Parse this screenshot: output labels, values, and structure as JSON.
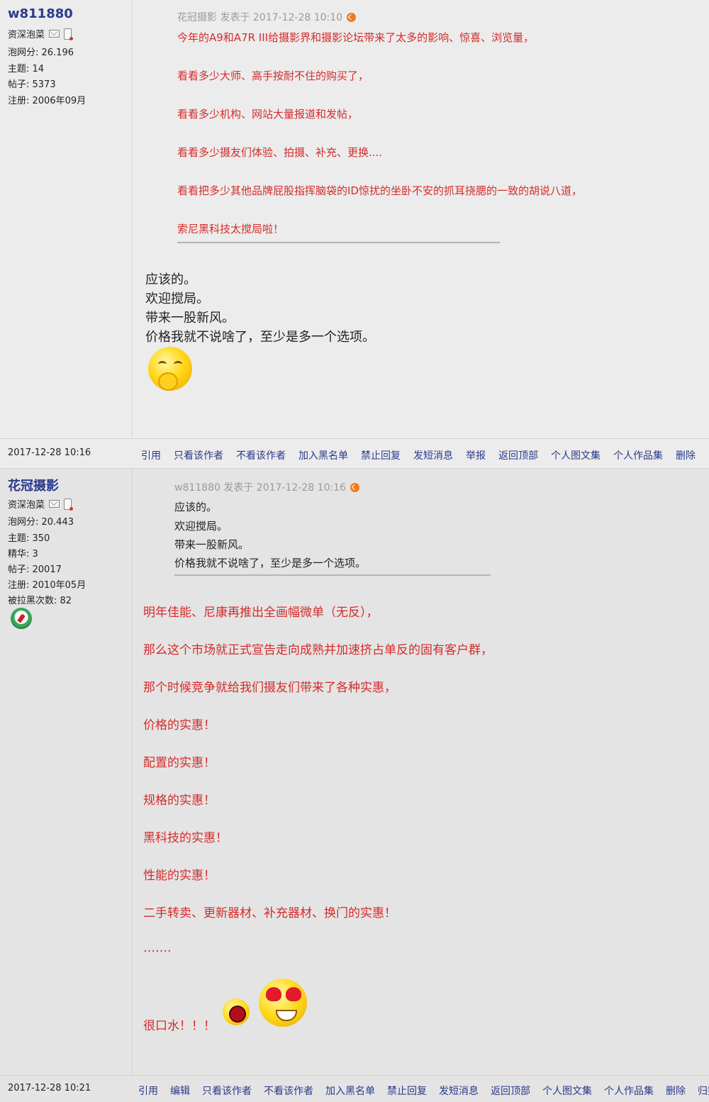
{
  "post1": {
    "author": {
      "name": "w811880",
      "rank": "资深泡菜",
      "stats": [
        "泡网分: 26.196",
        "主题: 14",
        "帖子: 5373",
        "注册: 2006年09月"
      ]
    },
    "quote": {
      "header": "花冠摄影 发表于 2017-12-28 10:10",
      "lines": [
        "今年的A9和A7R III给摄影界和摄影论坛带来了太多的影响、惊喜、浏览量，",
        "看看多少大师、高手按耐不住的购买了，",
        "看看多少机构、网站大量报道和发帖，",
        "看看多少摄友们体验、拍摄、补充、更换....",
        "看看把多少其他品牌屁股指挥脑袋的ID惊扰的坐卧不安的抓耳挠腮的一致的胡说八道，",
        "索尼黑科技太搅局啦！"
      ]
    },
    "reply": [
      "应该的。",
      "欢迎搅局。",
      "带来一股新风。",
      "价格我就不说啥了，至少是多一个选项。"
    ],
    "footer": {
      "time": "2017-12-28 10:16",
      "actions": [
        "引用",
        "只看该作者",
        "不看该作者",
        "加入黑名单",
        "禁止回复",
        "发短消息",
        "举报",
        "返回顶部",
        "个人图文集",
        "个人作品集",
        "删除"
      ]
    }
  },
  "post2": {
    "author": {
      "name": "花冠摄影",
      "rank": "资深泡菜",
      "stats": [
        "泡网分: 20.443",
        "主题: 350",
        "精华: 3",
        "帖子: 20017",
        "注册: 2010年05月",
        "被拉黑次数: 82"
      ]
    },
    "quote": {
      "header": "w811880 发表于 2017-12-28 10:16",
      "lines": [
        "应该的。",
        "欢迎搅局。",
        "带来一股新风。",
        "价格我就不说啥了，至少是多一个选项。"
      ]
    },
    "reply": [
      "明年佳能、尼康再推出全画幅微单（无反），",
      "那么这个市场就正式宣告走向成熟并加速挤占单反的固有客户群，",
      "那个时候竞争就给我们摄友们带来了各种实惠，",
      "价格的实惠！",
      "配置的实惠！",
      "规格的实惠！",
      "黑科技的实惠！",
      "性能的实惠！",
      "二手转卖、更新器材、补充器材、换门的实惠！",
      "……."
    ],
    "closing": "很口水！！！",
    "footer": {
      "time": "2017-12-28 10:21",
      "actions": [
        "引用",
        "编辑",
        "只看该作者",
        "不看该作者",
        "加入黑名单",
        "禁止回复",
        "发短消息",
        "返回顶部",
        "个人图文集",
        "个人作品集",
        "删除",
        "归鉴"
      ]
    }
  }
}
